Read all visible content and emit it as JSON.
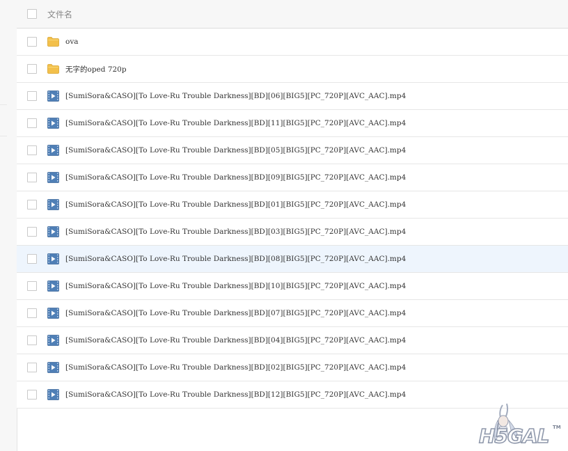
{
  "header": {
    "column_label": "文件名"
  },
  "colors": {
    "folder": "#f3c04b",
    "video_icon": "#4f7fb6",
    "row_highlight": "#eef5fd"
  },
  "icons": {
    "folder": "folder-icon",
    "video": "video-file-icon"
  },
  "files": [
    {
      "type": "folder",
      "name": "ova"
    },
    {
      "type": "folder",
      "name": "无字的oped 720p"
    },
    {
      "type": "video",
      "name": "[SumiSora&CASO][To Love-Ru Trouble Darkness][BD][06][BIG5][PC_720P][AVC_AAC].mp4"
    },
    {
      "type": "video",
      "name": "[SumiSora&CASO][To Love-Ru Trouble Darkness][BD][11][BIG5][PC_720P][AVC_AAC].mp4"
    },
    {
      "type": "video",
      "name": "[SumiSora&CASO][To Love-Ru Trouble Darkness][BD][05][BIG5][PC_720P][AVC_AAC].mp4"
    },
    {
      "type": "video",
      "name": "[SumiSora&CASO][To Love-Ru Trouble Darkness][BD][09][BIG5][PC_720P][AVC_AAC].mp4"
    },
    {
      "type": "video",
      "name": "[SumiSora&CASO][To Love-Ru Trouble Darkness][BD][01][BIG5][PC_720P][AVC_AAC].mp4"
    },
    {
      "type": "video",
      "name": "[SumiSora&CASO][To Love-Ru Trouble Darkness][BD][03][BIG5][PC_720P][AVC_AAC].mp4"
    },
    {
      "type": "video",
      "name": "[SumiSora&CASO][To Love-Ru Trouble Darkness][BD][08][BIG5][PC_720P][AVC_AAC].mp4",
      "highlighted": true
    },
    {
      "type": "video",
      "name": "[SumiSora&CASO][To Love-Ru Trouble Darkness][BD][10][BIG5][PC_720P][AVC_AAC].mp4"
    },
    {
      "type": "video",
      "name": "[SumiSora&CASO][To Love-Ru Trouble Darkness][BD][07][BIG5][PC_720P][AVC_AAC].mp4"
    },
    {
      "type": "video",
      "name": "[SumiSora&CASO][To Love-Ru Trouble Darkness][BD][04][BIG5][PC_720P][AVC_AAC].mp4"
    },
    {
      "type": "video",
      "name": "[SumiSora&CASO][To Love-Ru Trouble Darkness][BD][02][BIG5][PC_720P][AVC_AAC].mp4"
    },
    {
      "type": "video",
      "name": "[SumiSora&CASO][To Love-Ru Trouble Darkness][BD][12][BIG5][PC_720P][AVC_AAC].mp4"
    }
  ],
  "watermark": {
    "text": "H5GAL",
    "trademark": "TM"
  }
}
